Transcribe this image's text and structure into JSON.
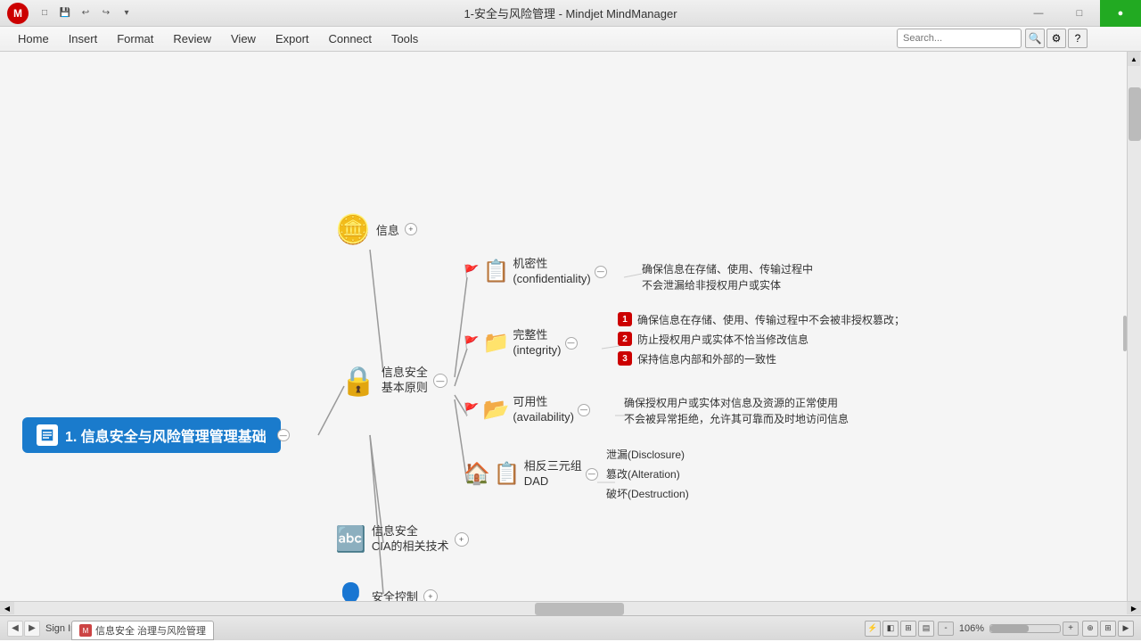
{
  "titlebar": {
    "logo_text": "M",
    "title": "1-安全与风险管理 - Mindjet MindManager",
    "minimize": "—",
    "maximize": "□",
    "close": "✕"
  },
  "quickbar": {
    "buttons": [
      "□",
      "💾",
      "↩",
      "↪",
      "▾"
    ]
  },
  "menubar": {
    "items": [
      "Home",
      "Insert",
      "Format",
      "Review",
      "View",
      "Export",
      "Connect",
      "Tools"
    ]
  },
  "green_btn": "●",
  "canvas": {
    "nodes": {
      "main_topic": {
        "text": "1. 信息安全与风险管理管理基础",
        "icon": "📄"
      },
      "node_info": {
        "label": "信息",
        "expand": "+"
      },
      "node_security": {
        "label": "信息安全\n基本原则",
        "expand": "—"
      },
      "node_cia": {
        "label": "信息安全\nCIA的相关技术",
        "expand": "+"
      },
      "node_control": {
        "label": "安全控制",
        "expand": "+"
      },
      "branch_confidentiality": {
        "label": "机密性\n(confidentiality)",
        "desc": "确保信息在存储、使用、传输过程中\n不会泄漏给非授权用户或实体"
      },
      "branch_integrity": {
        "label": "完整性\n(integrity)",
        "desc1": "确保信息在存储、使用、传输过程中不会被非授权篡改；",
        "desc2": "防止授权用户或实体不恰当修改信息",
        "desc3": "保持信息内部和外部的一致性",
        "nums": [
          "1",
          "2",
          "3"
        ]
      },
      "branch_availability": {
        "label": "可用性\n(availability)",
        "desc": "确保授权用户或实体对信息及资源的正常使用\n不会被异常拒绝，允许其可靠而及时地访问信息"
      },
      "branch_dad": {
        "label": "相反三元组\nDAD",
        "items": [
          "泄漏(Disclosure)",
          "篡改(Alteration)",
          "破坏(Destruction)"
        ]
      }
    }
  },
  "statusbar": {
    "sign_in": "Sign In",
    "sign_in_arrow": "▾",
    "tab_label": "信息安全 治理与风险管理",
    "zoom": "106%",
    "nav_left": "◀",
    "nav_right": "▶"
  }
}
